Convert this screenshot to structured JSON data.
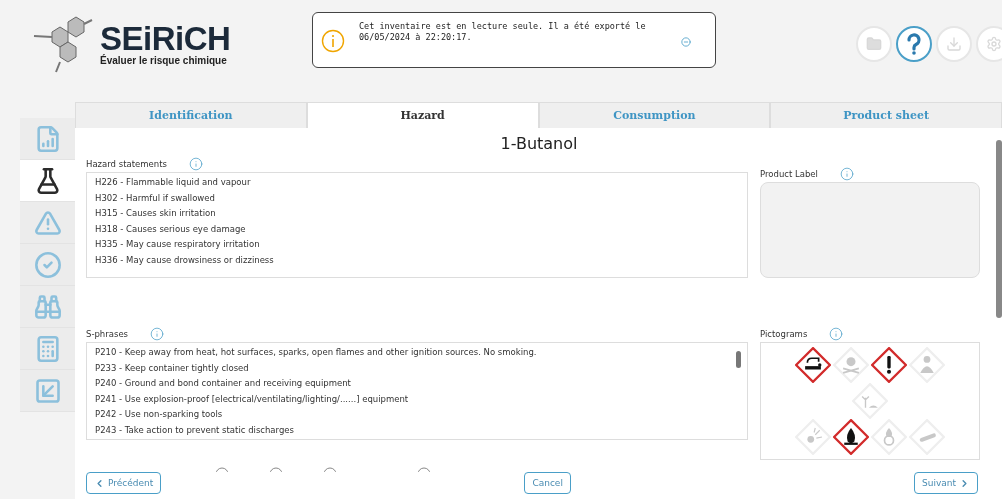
{
  "logo": {
    "name": "SEiRiCH",
    "tagline": "Évaluer le risque chimique"
  },
  "notice": {
    "text": "Cet inventaire est en lecture seule. Il a été exporté le 06/05/2024 à 22:20:17."
  },
  "toolbar": [
    {
      "kind": "folder",
      "active": false
    },
    {
      "kind": "help",
      "active": true
    },
    {
      "kind": "download",
      "active": false
    },
    {
      "kind": "settings",
      "active": false
    }
  ],
  "tabs": [
    {
      "label": "Identification",
      "selected": false
    },
    {
      "label": "Hazard",
      "selected": true
    },
    {
      "label": "Consumption",
      "selected": false
    },
    {
      "label": "Product sheet",
      "selected": false
    }
  ],
  "sidebar": [
    {
      "kind": "report",
      "selected": false
    },
    {
      "kind": "flask",
      "selected": true
    },
    {
      "kind": "warning",
      "selected": false
    },
    {
      "kind": "check",
      "selected": false
    },
    {
      "kind": "binoculars",
      "selected": false
    },
    {
      "kind": "calculator",
      "selected": false
    },
    {
      "kind": "export",
      "selected": false
    }
  ],
  "product_name": "1-Butanol",
  "hazard_statements": {
    "label": "Hazard statements",
    "items": [
      {
        "code": "H226 -",
        "text": "Flammable liquid and vapour"
      },
      {
        "code": "H302 -",
        "text": "Harmful if swallowed"
      },
      {
        "code": "H315 -",
        "text": "Causes skin irritation"
      },
      {
        "code": "H318 -",
        "text": "Causes serious eye damage"
      },
      {
        "code": "H335 -",
        "text": "May cause respiratory irritation"
      },
      {
        "code": "H336 -",
        "text": "May cause drowsiness or dizziness"
      }
    ]
  },
  "product_label": {
    "label": "Product Label"
  },
  "s_phrases": {
    "label": "S-phrases",
    "items": [
      {
        "code": "P210 -",
        "text": "Keep away from heat, hot surfaces, sparks, open flames and other ignition sources. No smoking."
      },
      {
        "code": "P233 -",
        "text": "Keep container tightly closed"
      },
      {
        "code": "P240 -",
        "text": "Ground and bond container and receiving equipment"
      },
      {
        "code": "P241 -",
        "text": "Use explosion-proof [electrical/ventilating/lighting/......] equipment"
      },
      {
        "code": "P242 -",
        "text": "Use non-sparking tools"
      },
      {
        "code": "P243 -",
        "text": "Take action to prevent static discharges"
      }
    ]
  },
  "pictograms": {
    "label": "Pictograms",
    "rows": [
      [
        {
          "kind": "corrosion",
          "active": true
        },
        {
          "kind": "skull",
          "active": false
        },
        {
          "kind": "exclamation",
          "active": true
        },
        {
          "kind": "health",
          "active": false
        }
      ],
      [
        {
          "kind": "environment",
          "active": false
        }
      ],
      [
        {
          "kind": "explosive",
          "active": false
        },
        {
          "kind": "flame",
          "active": true
        },
        {
          "kind": "oxidizer",
          "active": false
        },
        {
          "kind": "gas",
          "active": false
        }
      ]
    ]
  },
  "buttons": {
    "previous": "Précédent",
    "cancel": "Cancel",
    "next": "Suivant"
  }
}
